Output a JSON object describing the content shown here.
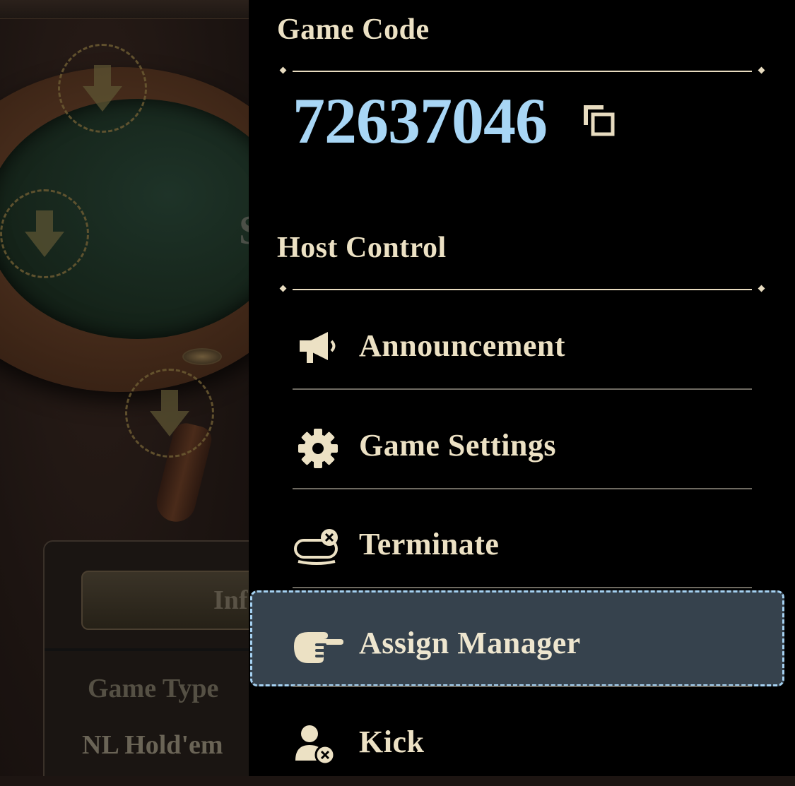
{
  "background": {
    "felt_text": "S",
    "info_tab_label": "Inf",
    "game_type_label": "Game Type",
    "game_type_value": "NL Hold'em"
  },
  "panel": {
    "game_code_heading": "Game Code",
    "game_code_value": "72637046",
    "host_control_heading": "Host Control",
    "items": [
      {
        "label": "Announcement",
        "icon": "megaphone-icon"
      },
      {
        "label": "Game Settings",
        "icon": "gear-icon"
      },
      {
        "label": "Terminate",
        "icon": "terminate-table-icon"
      },
      {
        "label": "Assign Manager",
        "icon": "pointing-hand-icon",
        "state": "focused"
      },
      {
        "label": "Kick",
        "icon": "kick-user-icon"
      }
    ]
  },
  "colors": {
    "panel_bg": "#000000",
    "heading": "#ece1c4",
    "code": "#a8d6f5",
    "highlight_bg": "#36424d",
    "highlight_border": "#a6d2f2"
  }
}
